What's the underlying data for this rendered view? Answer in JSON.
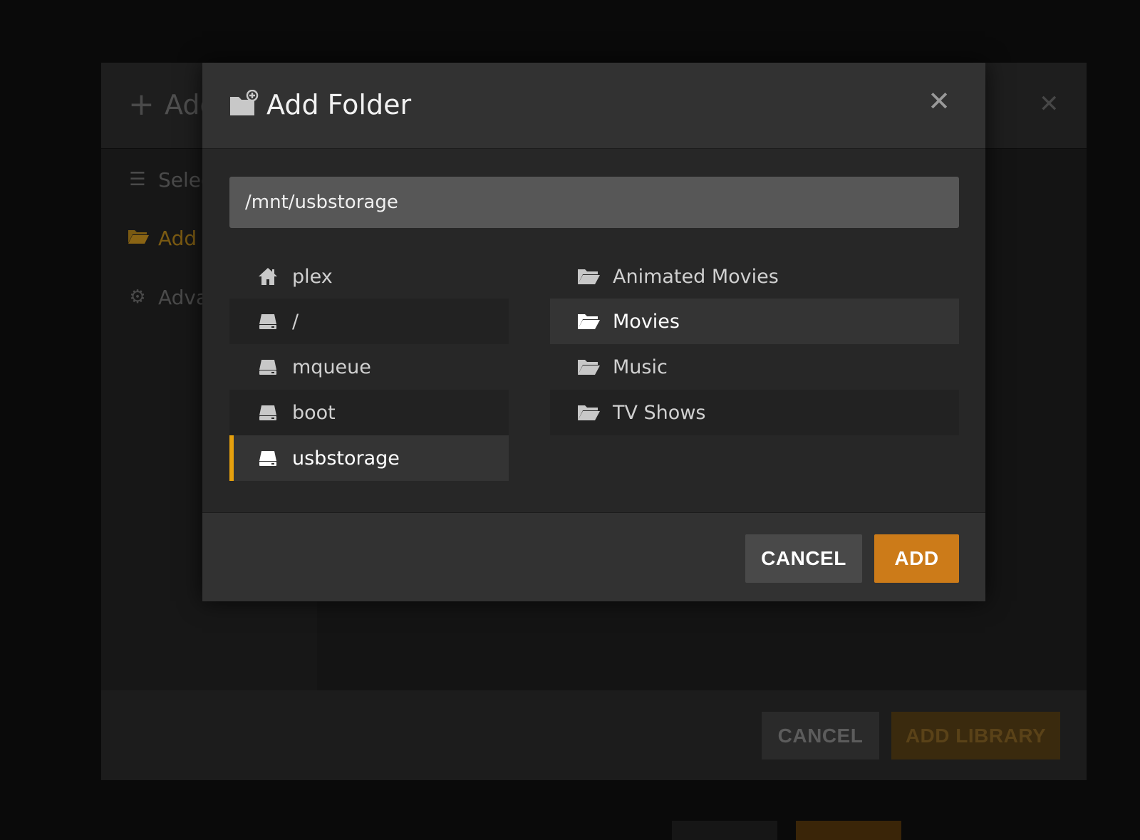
{
  "background_dialog": {
    "title": "Add Library",
    "close_glyph": "✕",
    "sidebar": [
      {
        "label": "Select type",
        "icon": "list-icon"
      },
      {
        "label": "Add folders",
        "icon": "folder-open-icon",
        "active": true
      },
      {
        "label": "Advanced",
        "icon": "gear-icon"
      }
    ],
    "cancel_label": "CANCEL",
    "add_library_label": "ADD LIBRARY"
  },
  "modal": {
    "title": "Add Folder",
    "title_icon": "folder-add-icon",
    "close_glyph": "✕",
    "path_value": "/mnt/usbstorage",
    "locations": [
      {
        "label": "plex",
        "icon": "home-icon"
      },
      {
        "label": "/",
        "icon": "drive-icon"
      },
      {
        "label": "mqueue",
        "icon": "drive-icon"
      },
      {
        "label": "boot",
        "icon": "drive-icon"
      },
      {
        "label": "usbstorage",
        "icon": "drive-icon",
        "selected": true
      }
    ],
    "folders": [
      {
        "label": "Animated Movies",
        "icon": "folder-open-icon"
      },
      {
        "label": "Movies",
        "icon": "folder-open-icon",
        "highlighted": true
      },
      {
        "label": "Music",
        "icon": "folder-open-icon"
      },
      {
        "label": "TV Shows",
        "icon": "folder-open-icon"
      }
    ],
    "cancel_label": "CANCEL",
    "add_label": "ADD"
  },
  "colors": {
    "accent": "#e5a00d",
    "add_button": "#cc7b19",
    "modal_bg": "#272727",
    "header_bg": "#323232"
  }
}
